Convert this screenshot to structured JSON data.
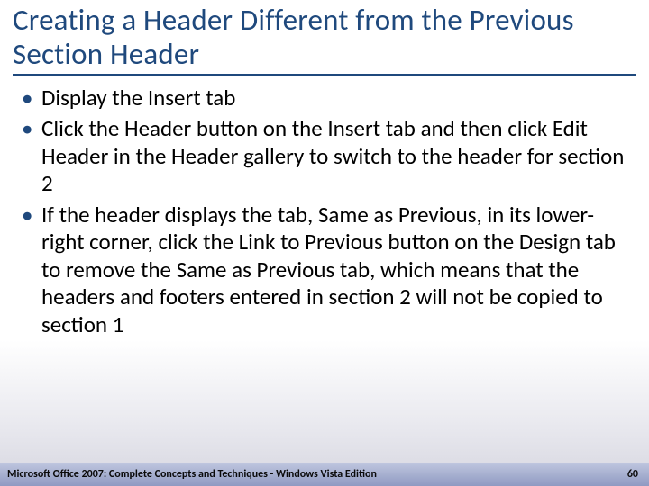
{
  "slide": {
    "title": "Creating a Header Different from the Previous Section Header",
    "bullets": [
      "Display the Insert tab",
      "Click the Header button on the Insert tab and then click Edit Header in the Header gallery to switch to the header for section 2",
      "If the header displays the tab, Same as Previous, in its lower-right corner, click the Link to Previous button on the Design tab to remove the Same as Previous tab, which means that the headers and footers entered in section 2 will not be copied to section 1"
    ]
  },
  "footer": {
    "left": "Microsoft Office 2007: Complete Concepts and Techniques - Windows Vista Edition",
    "page": "60"
  }
}
